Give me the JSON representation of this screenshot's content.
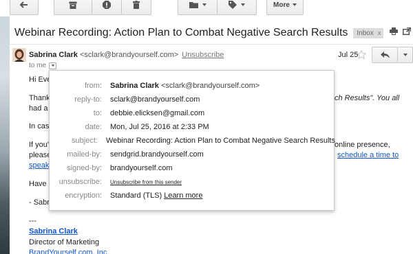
{
  "toolbar": {
    "more_label": "More"
  },
  "subject": {
    "title": "Webinar Recording: Action Plan to Combat Negative Search Results",
    "label": "Inbox",
    "label_close": "x"
  },
  "message": {
    "sender_name": "Sabrina Clark",
    "sender_email": "<sclark@brandyourself.com>",
    "unsubscribe": "Unsubscribe",
    "date": "Jul 25",
    "to": "to me",
    "body_lines": [
      "Hi Eve",
      "Thank",
      "ch Results\". You all",
      "had a",
      "In case",
      "If you'r",
      "online presence,",
      "please",
      "schedule a time to",
      "speak",
      "Have a",
      "- Sabr",
      "---"
    ],
    "signature_name": "Sabrina Clark",
    "signature_title": "Director of Marketing",
    "signature_company": "BrandYourself.com, Inc."
  },
  "details": {
    "rows": [
      {
        "key": "from:",
        "value_bold": "Sabrina Clark",
        "value": " <sclark@brandyourself.com>"
      },
      {
        "key": "reply-to:",
        "value": "sclark@brandyourself.com"
      },
      {
        "key": "to:",
        "value": "debbie.elicksen@gmail.com"
      },
      {
        "key": "date:",
        "value": "Mon, Jul 25, 2016 at 2:33 PM"
      },
      {
        "key": "subject:",
        "value": "Webinar Recording: Action Plan to Combat Negative Search Results"
      },
      {
        "key": "mailed-by:",
        "value": "sendgrid.brandyourself.com"
      },
      {
        "key": "signed-by:",
        "value": "brandyourself.com"
      },
      {
        "key": "unsubscribe:",
        "value": "Unsubscribe from this sender"
      },
      {
        "key": "encryption:",
        "value": "Standard (TLS)",
        "link": "Learn more"
      }
    ]
  }
}
